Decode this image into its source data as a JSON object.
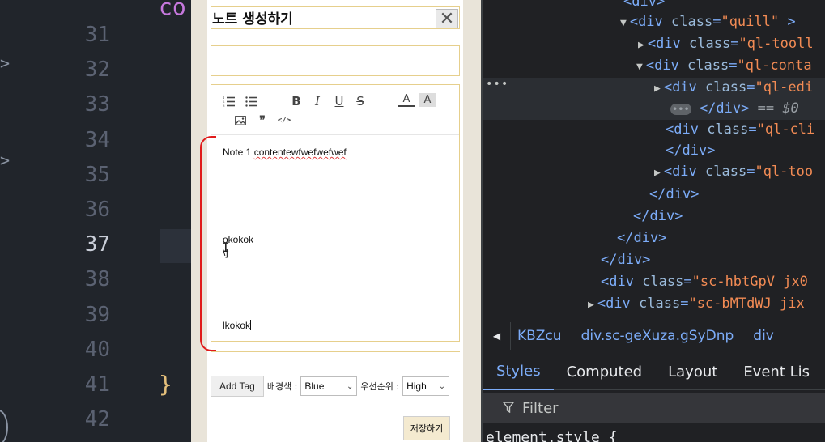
{
  "editor": {
    "line_numbers": [
      "31",
      "32",
      "33",
      "34",
      "35",
      "36",
      "37",
      "38",
      "39",
      "40",
      "41",
      "42"
    ],
    "active_line": "37",
    "top_fragment": "co",
    "closing_brace": "}",
    "gutter_glyphs": [
      ">",
      ">"
    ]
  },
  "modal": {
    "title": "노트 생성하기",
    "close_glyph": "✕",
    "title_input_value": "",
    "toolbar_icons": [
      "ordered-list-icon",
      "bullet-list-icon",
      "bold-icon",
      "italic-icon",
      "underline-icon",
      "strike-icon",
      "font-color-icon",
      "background-color-icon",
      "image-icon",
      "blockquote-icon",
      "code-block-icon"
    ],
    "toolbar_glyphs": {
      "bold": "B",
      "italic": "I",
      "underline": "U",
      "strike": "S",
      "color": "A",
      "background": "A",
      "quote": "❞",
      "code": "</>"
    },
    "content": {
      "line1": "Note 1 contentewfwefwefwef",
      "line2": "okokok",
      "line3": "\\]",
      "line4": "lkokok"
    },
    "add_tag_label": "Add Tag",
    "bg_color_label": "배경색 :",
    "bg_color_value": "Blue",
    "priority_label": "우선순위 :",
    "priority_value": "High",
    "save_label": "저장하기"
  },
  "devtools": {
    "dom": [
      {
        "indent": 0,
        "open": "",
        "tag": "<div>",
        "partial": true
      },
      {
        "indent": 1,
        "tri": "▼",
        "tag": "<div",
        "attr": "class",
        "val": "\"quill\"",
        "close": ">"
      },
      {
        "indent": 2,
        "tri": "▶",
        "tag": "<div",
        "attr": "class",
        "val": "\"ql-tooll",
        "close": ""
      },
      {
        "indent": 2,
        "tri": "▼",
        "tag": "<div",
        "attr": "class",
        "val": "\"ql-conta",
        "close": ""
      },
      {
        "indent": 3,
        "tri": "▶",
        "tag": "<div",
        "attr": "class",
        "val": "\"ql-edi",
        "close": ""
      },
      {
        "indent": 4,
        "tri": "",
        "tag": "</div>",
        "attr": "",
        "val": "",
        "close": " == $0"
      },
      {
        "indent": 3,
        "tri": "",
        "tag": "<div",
        "attr": "class",
        "val": "\"ql-cli",
        "close": ""
      },
      {
        "indent": 3,
        "tri": "",
        "tag": "</div>",
        "attr": "",
        "val": "",
        "close": ""
      },
      {
        "indent": 3,
        "tri": "▶",
        "tag": "<div",
        "attr": "class",
        "val": "\"ql-too",
        "close": ""
      },
      {
        "indent": 2,
        "tri": "",
        "tag": "</div>",
        "attr": "",
        "val": "",
        "close": ""
      },
      {
        "indent": 1,
        "tri": "",
        "tag": "</div>",
        "attr": "",
        "val": "",
        "close": ""
      },
      {
        "indent": 0,
        "tri": "",
        "tag": "</div>",
        "attr": "",
        "val": "",
        "close": ""
      },
      {
        "indent": -1,
        "tri": "",
        "tag": "</div>",
        "attr": "",
        "val": "",
        "close": ""
      },
      {
        "indent": -1,
        "tri": "",
        "tag": "<div",
        "attr": "class",
        "val": "\"sc-hbtGpV jx0",
        "close": ""
      },
      {
        "indent": -2,
        "tri": "▶",
        "tag": "<div",
        "attr": "class",
        "val": "\"sc-bMTdWJ jix",
        "close": ""
      }
    ],
    "selected_ellipsis": "•••",
    "breadcrumbs": [
      "KBZcu",
      "div.sc-geXuza.gSyDnp",
      "div"
    ],
    "tabs": [
      "Styles",
      "Computed",
      "Layout",
      "Event Lis"
    ],
    "active_tab": "Styles",
    "filter_placeholder": "Filter",
    "element_style": "element.style {"
  }
}
